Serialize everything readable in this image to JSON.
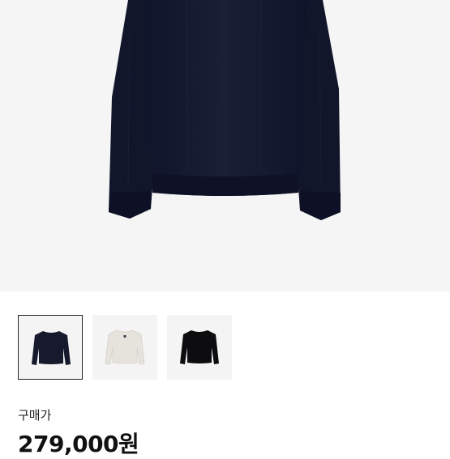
{
  "product": {
    "image_icon": "navy-knit-sweater-image",
    "colors": {
      "hero_background": "#f5f5f6",
      "sweater_navy": "#161a2c",
      "sweater_ivory": "#e8e6e0",
      "sweater_black": "#0d0d0f"
    }
  },
  "thumbnails": [
    {
      "icon": "navy-sweater-thumbnail",
      "selected": true
    },
    {
      "icon": "ivory-sweater-thumbnail",
      "selected": false
    },
    {
      "icon": "black-sweater-thumbnail",
      "selected": false
    }
  ],
  "price": {
    "label": "구매가",
    "value": "279,000원"
  }
}
